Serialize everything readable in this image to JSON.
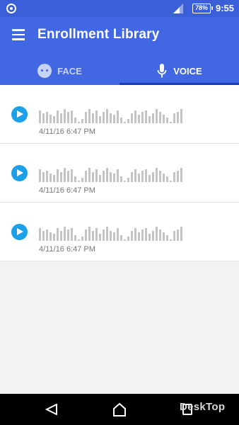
{
  "status_bar": {
    "battery": "78%",
    "time": "9:55"
  },
  "app_bar": {
    "title": "Enrollment Library"
  },
  "tabs": [
    {
      "label": "FACE",
      "icon": "face-icon",
      "selected": false
    },
    {
      "label": "VOICE",
      "icon": "mic-icon",
      "selected": true
    }
  ],
  "recordings": [
    {
      "timestamp": "4/11/16 6:47 PM"
    },
    {
      "timestamp": "4/11/16 6:47 PM"
    },
    {
      "timestamp": "4/11/16 6:47 PM"
    }
  ],
  "watermark": "DeskTop",
  "colors": {
    "status_bar": "#3a5fd9",
    "app_bar": "#4267e2",
    "play_button": "#1ca0e8",
    "waveform": "#c4c4c4"
  }
}
